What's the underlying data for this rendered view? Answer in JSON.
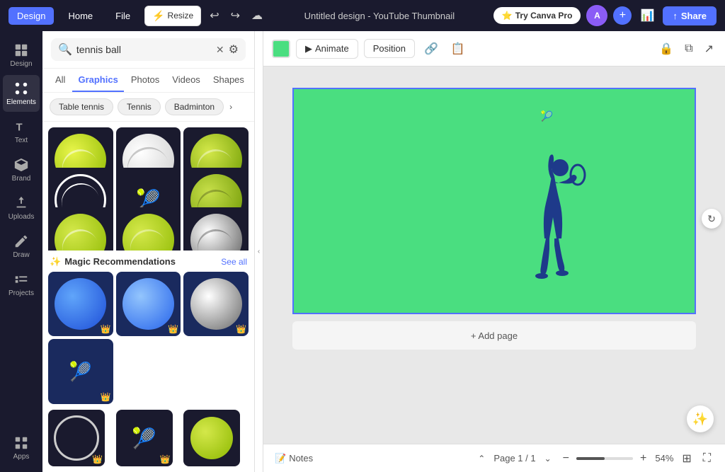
{
  "topNav": {
    "tabs": [
      "Design",
      "Home",
      "File"
    ],
    "activeTab": "Design",
    "resizeLabel": "Resize",
    "title": "Untitled design - YouTube Thumbnail",
    "tryProLabel": "Try Canva Pro",
    "shareLabel": "Share",
    "addLabel": "+"
  },
  "sidebar": {
    "items": [
      {
        "id": "design",
        "label": "Design"
      },
      {
        "id": "elements",
        "label": "Elements"
      },
      {
        "id": "text",
        "label": "Text"
      },
      {
        "id": "brand",
        "label": "Brand"
      },
      {
        "id": "uploads",
        "label": "Uploads"
      },
      {
        "id": "draw",
        "label": "Draw"
      },
      {
        "id": "projects",
        "label": "Projects"
      },
      {
        "id": "apps",
        "label": "Apps"
      }
    ],
    "activeItem": "elements"
  },
  "leftPanel": {
    "searchPlaceholder": "tennis ball",
    "searchValue": "tennis ball",
    "tabs": [
      "All",
      "Graphics",
      "Photos",
      "Videos",
      "Shapes"
    ],
    "activeTab": "Graphics",
    "chips": [
      "Table tennis",
      "Tennis",
      "Badminton"
    ],
    "magicLabel": "Magic Recommendations",
    "seeAllLabel": "See all"
  },
  "toolbar": {
    "animateLabel": "Animate",
    "positionLabel": "Position"
  },
  "canvas": {
    "addPageLabel": "+ Add page",
    "backgroundColor": "#4ade80"
  },
  "bottomBar": {
    "notesLabel": "Notes",
    "pageIndicator": "Page 1 / 1",
    "zoomLabel": "54%"
  }
}
